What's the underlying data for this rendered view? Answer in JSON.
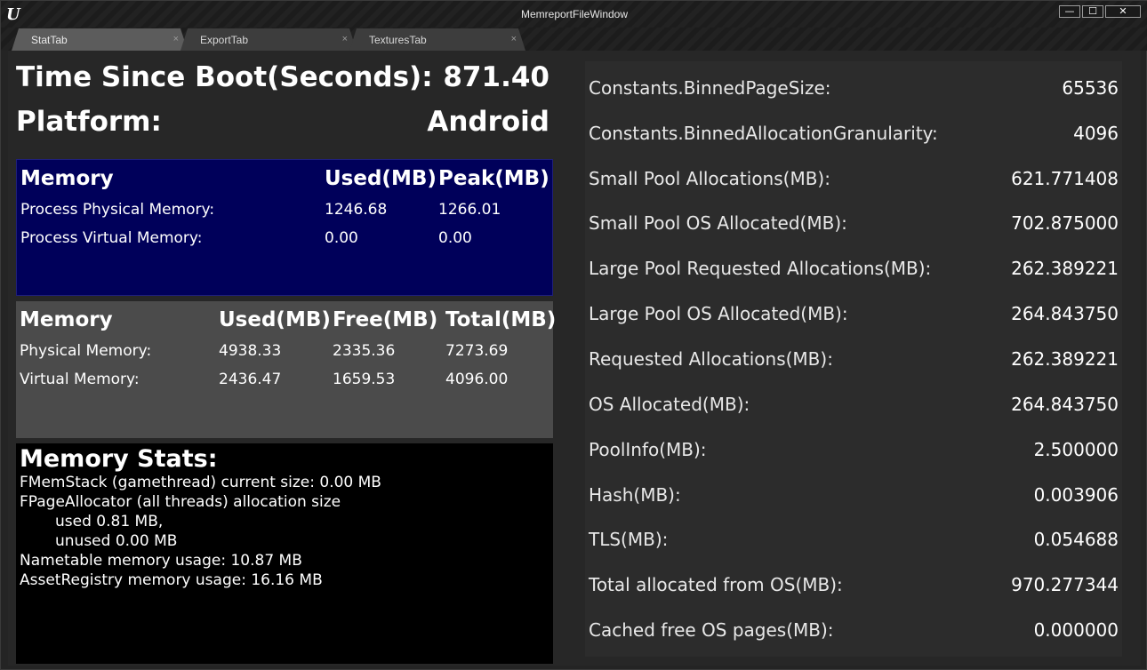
{
  "window": {
    "title": "MemreportFileWindow",
    "logo": "U",
    "minimize_label": "—",
    "maximize_label": "☐",
    "close_label": "✕"
  },
  "tabs": [
    {
      "label": "StatTab",
      "active": true,
      "close": "×"
    },
    {
      "label": "ExportTab",
      "active": false,
      "close": "×"
    },
    {
      "label": "TexturesTab",
      "active": false,
      "close": "×"
    }
  ],
  "summary": {
    "boot_label": "Time Since Boot(Seconds):",
    "boot_value": "871.40",
    "platform_label": "Platform:",
    "platform_value": "Android"
  },
  "process_table": {
    "headers": [
      "Memory",
      "Used(MB)",
      "Peak(MB)"
    ],
    "rows": [
      [
        "Process Physical Memory:",
        "1246.68",
        "1266.01"
      ],
      [
        "Process Virtual Memory:",
        "0.00",
        "0.00"
      ]
    ]
  },
  "system_table": {
    "headers": [
      "Memory",
      "Used(MB)",
      "Free(MB)",
      "Total(MB)"
    ],
    "rows": [
      [
        "Physical Memory:",
        "4938.33",
        "2335.36",
        "7273.69"
      ],
      [
        "Virtual Memory:",
        "2436.47",
        "1659.53",
        "4096.00"
      ]
    ]
  },
  "memory_stats": {
    "title": "Memory Stats:",
    "lines": [
      "FMemStack (gamethread) current size: 0.00 MB",
      "FPageAllocator (all threads) allocation size",
      "used 0.81 MB,",
      "unused 0.00 MB",
      "Nametable memory usage: 10.87 MB",
      "AssetRegistry memory usage: 16.16 MB"
    ]
  },
  "allocator_stats": [
    {
      "label": "Constants.BinnedPageSize:",
      "value": "65536"
    },
    {
      "label": "Constants.BinnedAllocationGranularity:",
      "value": "4096"
    },
    {
      "label": "Small Pool Allocations(MB):",
      "value": "621.771408"
    },
    {
      "label": "Small Pool OS Allocated(MB):",
      "value": "702.875000"
    },
    {
      "label": "Large Pool Requested Allocations(MB):",
      "value": "262.389221"
    },
    {
      "label": "Large Pool OS Allocated(MB):",
      "value": "264.843750"
    },
    {
      "label": "Requested Allocations(MB):",
      "value": "262.389221"
    },
    {
      "label": "OS Allocated(MB):",
      "value": "264.843750"
    },
    {
      "label": "PoolInfo(MB):",
      "value": "2.500000"
    },
    {
      "label": "Hash(MB):",
      "value": "0.003906"
    },
    {
      "label": "TLS(MB):",
      "value": "0.054688"
    },
    {
      "label": "Total allocated from OS(MB):",
      "value": "970.277344"
    },
    {
      "label": "Cached free OS pages(MB):",
      "value": "0.000000"
    }
  ],
  "colors": {
    "process_panel_bg": "#00005a",
    "system_panel_bg": "#4b4b4b",
    "stats_panel_bg": "#000000"
  }
}
